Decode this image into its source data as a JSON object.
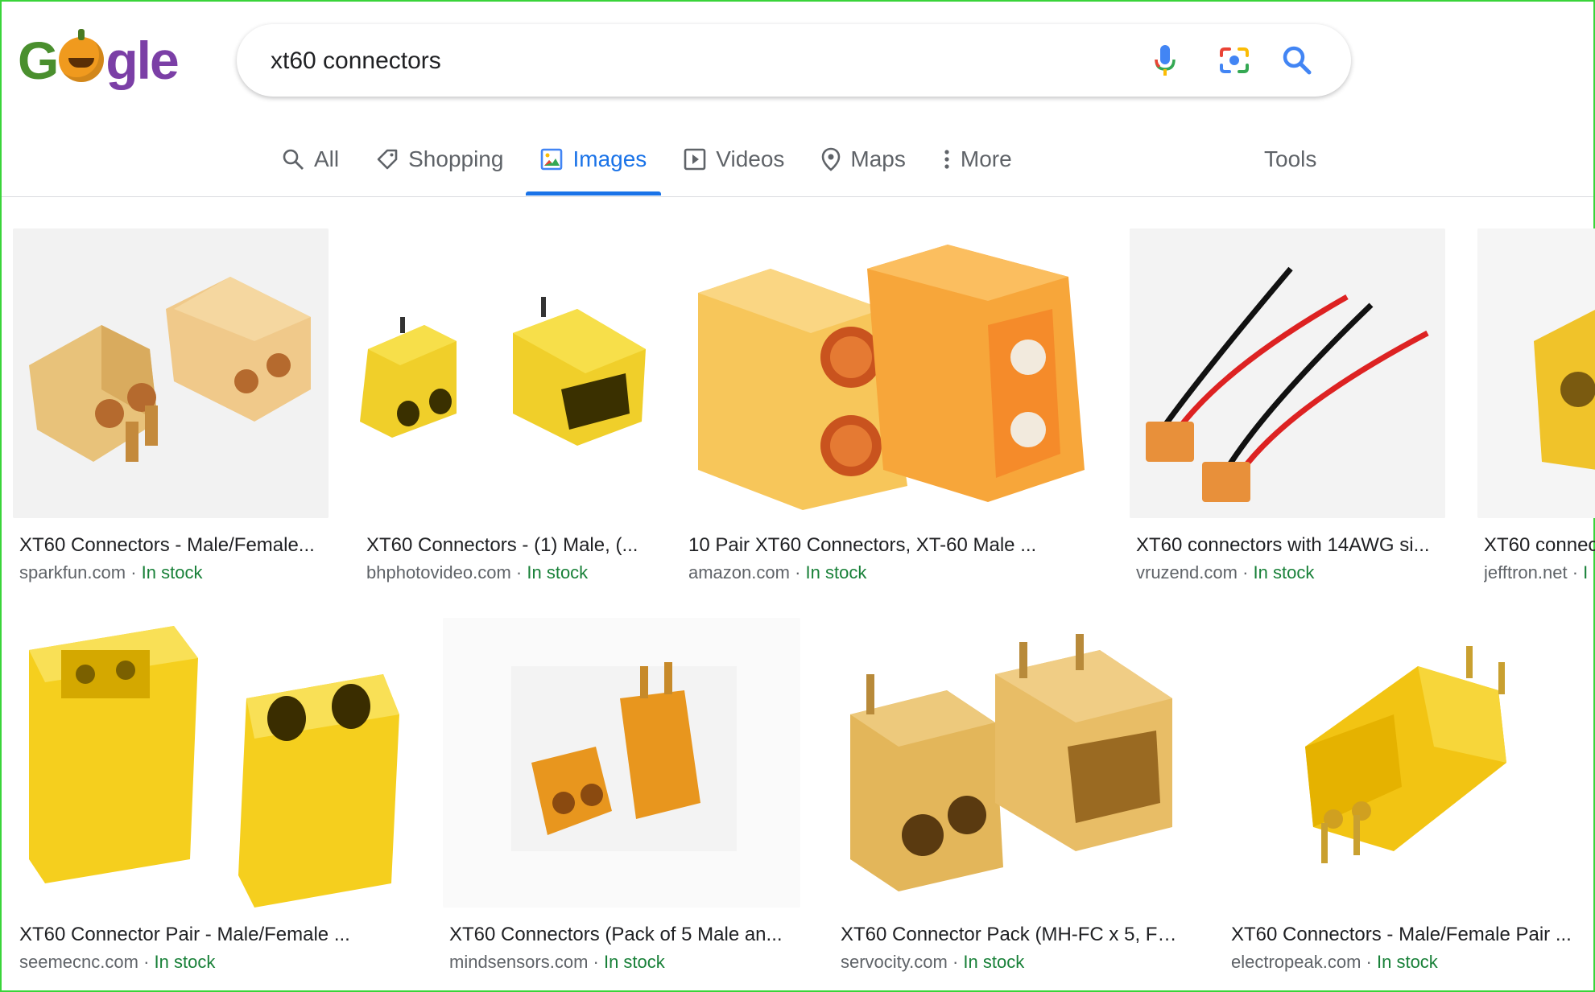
{
  "logo": {
    "text_start": "G",
    "text_end": "gle"
  },
  "search": {
    "value": "xt60 connectors",
    "placeholder": ""
  },
  "tabs": [
    {
      "label": "All",
      "icon": "search-icon"
    },
    {
      "label": "Shopping",
      "icon": "tag-icon"
    },
    {
      "label": "Images",
      "icon": "image-icon",
      "active": true
    },
    {
      "label": "Videos",
      "icon": "play-icon"
    },
    {
      "label": "Maps",
      "icon": "map-pin-icon"
    },
    {
      "label": "More",
      "icon": "more-vert-icon"
    }
  ],
  "tools_label": "Tools",
  "colors": {
    "accent": "#1a73e8",
    "stock": "#188038",
    "connector": "#f2c94c"
  },
  "results": [
    {
      "title": "XT60 Connectors - Male/Female...",
      "source": "sparkfun.com",
      "stock": "In stock"
    },
    {
      "title": "XT60 Connectors - (1) Male, (...",
      "source": "bhphotovideo.com",
      "stock": "In stock"
    },
    {
      "title": "10 Pair XT60 Connectors, XT-60 Male ...",
      "source": "amazon.com",
      "stock": "In stock"
    },
    {
      "title": "XT60 connectors with 14AWG si...",
      "source": "vruzend.com",
      "stock": "In stock"
    },
    {
      "title": "XT60 connec",
      "source": "jefftron.net",
      "stock": "I"
    },
    {
      "title": "XT60 Connector Pair - Male/Female ...",
      "source": "seemecnc.com",
      "stock": "In stock"
    },
    {
      "title": "XT60 Connectors (Pack of 5 Male an...",
      "source": "mindsensors.com",
      "stock": "In stock"
    },
    {
      "title": "XT60 Connector Pack (MH-FC x 5, FH...",
      "source": "servocity.com",
      "stock": "In stock"
    },
    {
      "title": "XT60 Connectors - Male/Female Pair ...",
      "source": "electropeak.com",
      "stock": "In stock"
    }
  ],
  "separator": "·"
}
